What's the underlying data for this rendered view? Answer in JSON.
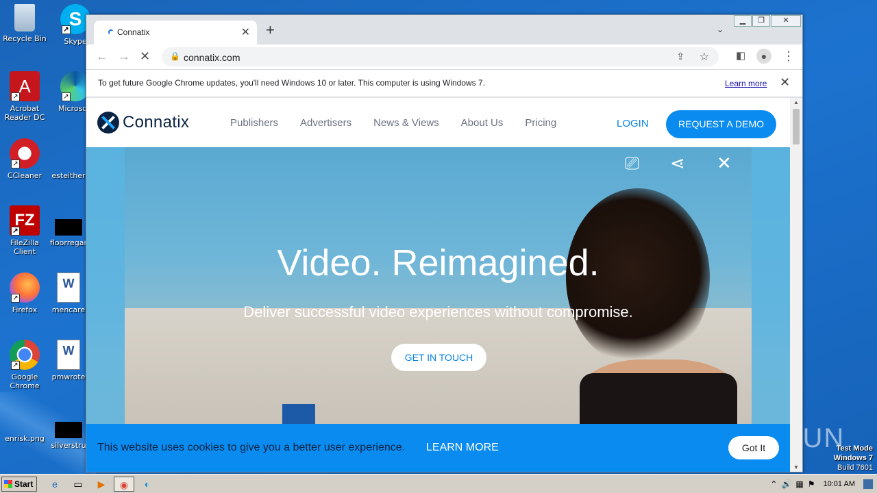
{
  "desktop": {
    "icons": [
      {
        "label": "Recycle Bin"
      },
      {
        "label": "Skype"
      },
      {
        "label": "Acrobat Reader DC"
      },
      {
        "label": "Microsoft"
      },
      {
        "label": "CCleaner"
      },
      {
        "label": "esteither"
      },
      {
        "label": "FileZilla Client"
      },
      {
        "label": "floorregar"
      },
      {
        "label": "Firefox"
      },
      {
        "label": "mencare"
      },
      {
        "label": "Google Chrome"
      },
      {
        "label": "pmwrote"
      },
      {
        "label": "enrisk.png"
      },
      {
        "label": "silverstru"
      }
    ],
    "watermark": "ANY RUN",
    "test_mode": [
      "Test Mode",
      "Windows 7",
      "Build 7601"
    ]
  },
  "browser": {
    "tab_title": "Connatix",
    "url": "connatix.com",
    "infobar": {
      "message": "To get future Google Chrome updates, you'll need Windows 10 or later. This computer is using Windows 7.",
      "link": "Learn more"
    }
  },
  "site": {
    "logo_text": "Connatix",
    "nav": [
      "Publishers",
      "Advertisers",
      "News & Views",
      "About Us",
      "Pricing"
    ],
    "login": "LOGIN",
    "demo": "REQUEST A DEMO",
    "hero_title": "Video. Reimagined.",
    "hero_subtitle": "Deliver successful video experiences without compromise.",
    "cta": "GET IN TOUCH",
    "cookie": {
      "message": "This website uses cookies to give you a better user experience.",
      "learn_more": "LEARN MORE",
      "accept": "Got It"
    }
  },
  "taskbar": {
    "start": "Start",
    "clock": "10:01 AM"
  }
}
